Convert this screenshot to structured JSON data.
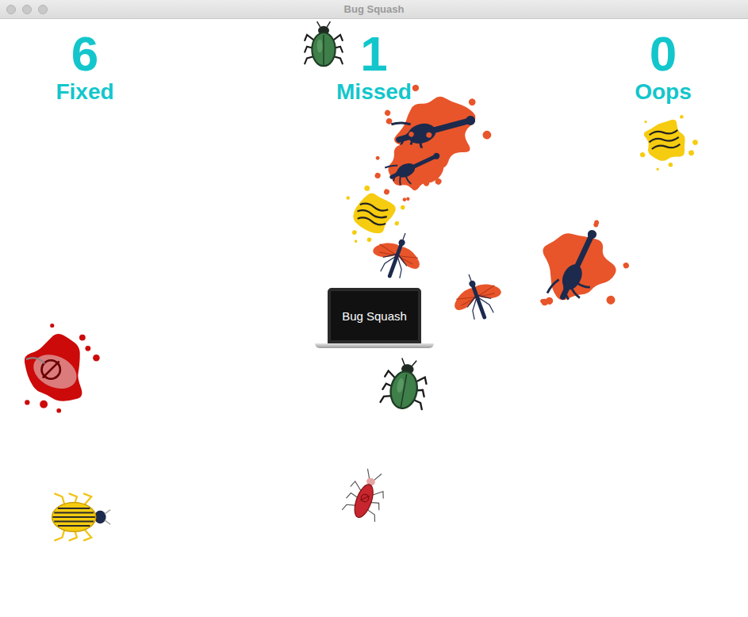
{
  "window": {
    "title": "Bug Squash"
  },
  "scores": [
    {
      "value": "6",
      "label": "Fixed"
    },
    {
      "value": "1",
      "label": "Missed"
    },
    {
      "value": "0",
      "label": "Oops"
    }
  ],
  "laptop": {
    "label": "Bug Squash"
  },
  "sprites": [
    {
      "kind": "green-beetle",
      "squashed": false
    },
    {
      "kind": "mosquito",
      "squashed": true
    },
    {
      "kind": "mosquito",
      "squashed": true
    },
    {
      "kind": "yellow-beetle",
      "squashed": true
    },
    {
      "kind": "yellow-beetle",
      "squashed": true
    },
    {
      "kind": "mosquito",
      "squashed": true
    },
    {
      "kind": "mosquito",
      "squashed": false
    },
    {
      "kind": "mosquito",
      "squashed": false
    },
    {
      "kind": "green-beetle",
      "squashed": false
    },
    {
      "kind": "red-bug",
      "squashed": true
    },
    {
      "kind": "yellow-beetle",
      "squashed": false
    },
    {
      "kind": "red-bug",
      "squashed": false
    }
  ]
}
